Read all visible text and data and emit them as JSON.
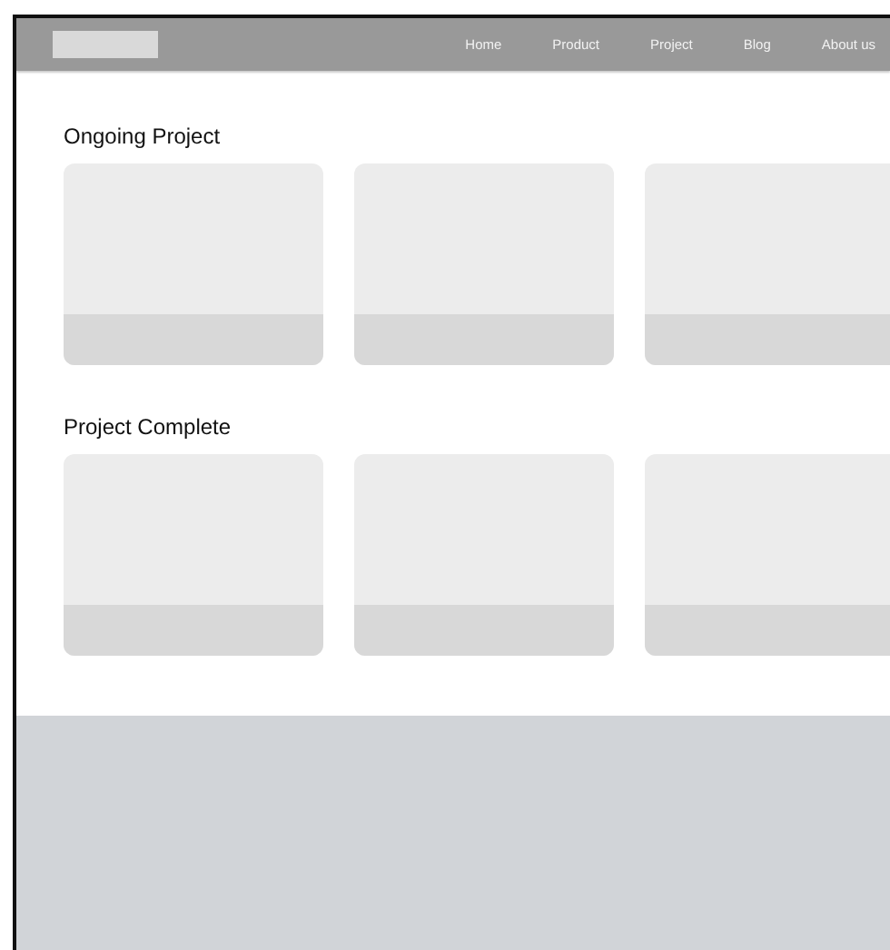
{
  "navbar": {
    "logo": {
      "kind": "placeholder"
    },
    "items": [
      "Home",
      "Product",
      "Project",
      "Blog",
      "About us"
    ]
  },
  "sections": [
    {
      "title": "Ongoing Project",
      "cards": [
        {
          "kind": "placeholder"
        },
        {
          "kind": "placeholder"
        },
        {
          "kind": "placeholder"
        }
      ]
    },
    {
      "title": "Project Complete",
      "cards": [
        {
          "kind": "placeholder"
        },
        {
          "kind": "placeholder"
        },
        {
          "kind": "placeholder"
        }
      ]
    }
  ],
  "footer": {
    "kind": "placeholder"
  }
}
